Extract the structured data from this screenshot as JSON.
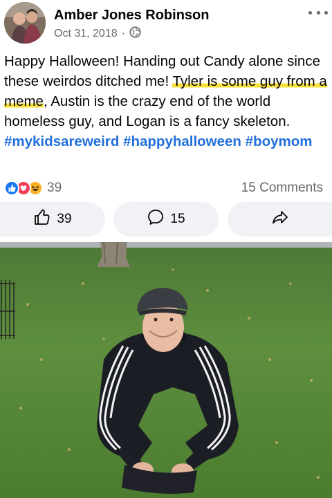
{
  "post": {
    "author": "Amber Jones Robinson",
    "date": "Oct 31, 2018",
    "separator": "·",
    "privacy_icon": "globe-icon",
    "text_part1": "Happy Halloween! Handing out Candy alone since these weirdos ditched me! ",
    "text_highlight": "Tyler is some guy from a meme",
    "text_part2": ", Austin is the crazy end of the world homeless guy, and Logan is a fancy skeleton. ",
    "hashtags": [
      "#mykidsareweird",
      "#happyhalloween",
      "#boymom"
    ]
  },
  "reactions": {
    "icons": [
      "like-reaction-icon",
      "love-reaction-icon",
      "haha-reaction-icon"
    ],
    "count": "39",
    "comments": "15 Comments"
  },
  "actions": {
    "like_count": "39",
    "comment_count": "15"
  },
  "colors": {
    "hashtag": "#216fdb",
    "like": "#1877f2",
    "love": "#f33e58",
    "highlight": "#f7e03a"
  }
}
